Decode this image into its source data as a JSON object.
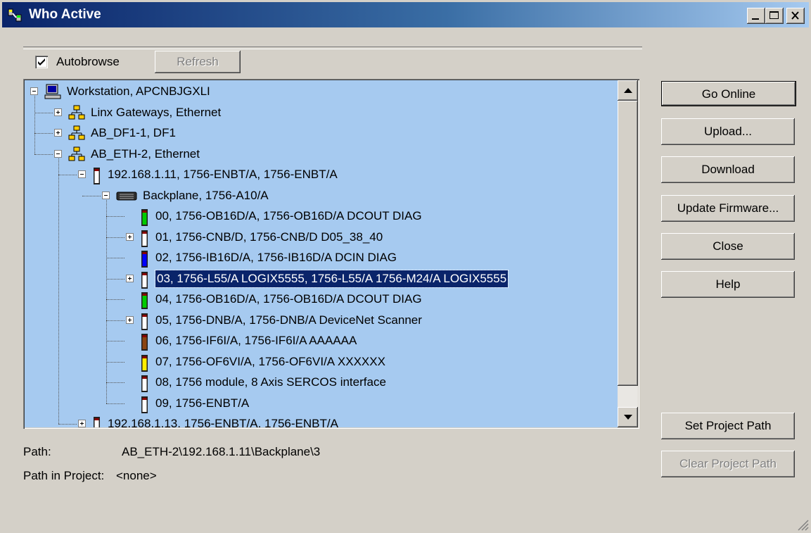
{
  "window": {
    "title": "Who Active",
    "min_icon": "minimize-icon",
    "max_icon": "maximize-icon",
    "close_icon": "close-icon"
  },
  "autobrowse": {
    "label": "Autobrowse",
    "checked": true
  },
  "refresh_label": "Refresh",
  "tree": [
    {
      "label": "Workstation, APCNBJGXLI",
      "icon": "computer-icon",
      "expander": "minus"
    },
    {
      "label": "Linx Gateways, Ethernet",
      "icon": "network-icon",
      "expander": "plus"
    },
    {
      "label": "AB_DF1-1, DF1",
      "icon": "network-icon",
      "expander": "plus"
    },
    {
      "label": "AB_ETH-2, Ethernet",
      "icon": "network-icon",
      "expander": "minus"
    },
    {
      "label": "192.168.1.11, 1756-ENBT/A, 1756-ENBT/A",
      "icon": "module-icon",
      "expander": "minus"
    },
    {
      "label": "Backplane, 1756-A10/A",
      "icon": "backplane-icon",
      "expander": "minus"
    },
    {
      "label": "00, 1756-OB16D/A, 1756-OB16D/A  DCOUT DIAG",
      "icon": "module-icon",
      "color": "#00cc00",
      "expander": "none"
    },
    {
      "label": "01, 1756-CNB/D, 1756-CNB/D D05_38_40",
      "icon": "module-icon",
      "color": "#ffffff",
      "expander": "plus"
    },
    {
      "label": "02, 1756-IB16D/A, 1756-IB16D/A  DCIN  DIAG",
      "icon": "module-icon",
      "color": "#0000ff",
      "expander": "none"
    },
    {
      "label": "03, 1756-L55/A LOGIX5555, 1756-L55/A 1756-M24/A LOGIX5555",
      "icon": "module-icon",
      "color": "#ffffff",
      "expander": "plus",
      "selected": true
    },
    {
      "label": "04, 1756-OB16D/A, 1756-OB16D/A  DCOUT DIAG",
      "icon": "module-icon",
      "color": "#00cc00",
      "expander": "none"
    },
    {
      "label": "05, 1756-DNB/A, 1756-DNB/A DeviceNet Scanner",
      "icon": "module-icon",
      "color": "#ffffff",
      "expander": "plus"
    },
    {
      "label": "06, 1756-IF6I/A, 1756-IF6I/A AAAAAA",
      "icon": "module-icon",
      "color": "#8b4513",
      "expander": "none"
    },
    {
      "label": "07, 1756-OF6VI/A, 1756-OF6VI/A XXXXXX",
      "icon": "module-icon",
      "color": "#ffee00",
      "expander": "none"
    },
    {
      "label": "08, 1756 module, 8 Axis SERCOS interface",
      "icon": "module-icon",
      "color": "#ffffff",
      "expander": "none"
    },
    {
      "label": "09, 1756-ENBT/A",
      "icon": "module-icon",
      "color": "#ffffff",
      "expander": "none"
    },
    {
      "label": "192.168.1.13, 1756-ENBT/A, 1756-ENBT/A",
      "icon": "module-icon",
      "expander": "plus"
    }
  ],
  "buttons": {
    "go_online": "Go Online",
    "upload": "Upload...",
    "download": "Download",
    "update_firmware": "Update Firmware...",
    "close": "Close",
    "help": "Help",
    "set_project_path": "Set Project Path",
    "clear_project_path": "Clear Project Path"
  },
  "path": {
    "label": "Path:",
    "value": "AB_ETH-2\\192.168.1.11\\Backplane\\3"
  },
  "path_in_project": {
    "label": "Path in Project:",
    "value": "<none>"
  }
}
